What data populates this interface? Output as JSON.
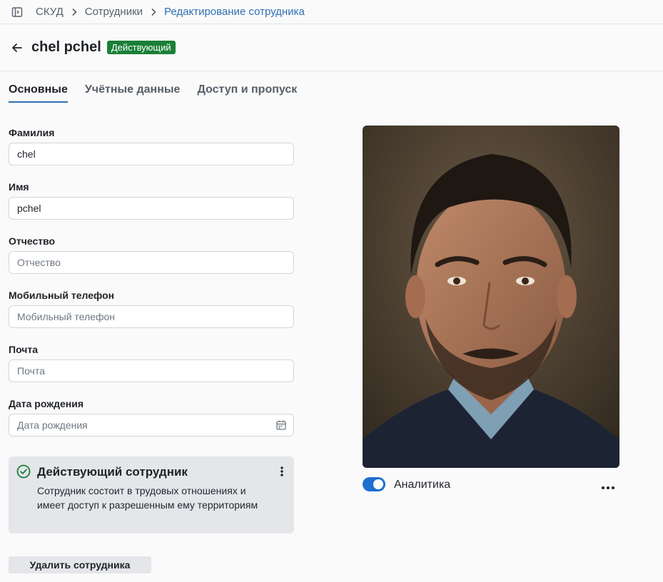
{
  "breadcrumb": {
    "items": [
      "СКУД",
      "Сотрудники",
      "Редактирование сотрудника"
    ]
  },
  "header": {
    "title": "chel pchel",
    "status_badge": "Действующий"
  },
  "tabs": [
    {
      "label": "Основные",
      "active": true
    },
    {
      "label": "Учётные данные",
      "active": false
    },
    {
      "label": "Доступ и пропуск",
      "active": false
    }
  ],
  "form": {
    "last_name": {
      "label": "Фамилия",
      "value": "chel",
      "placeholder": "Фамилия"
    },
    "first_name": {
      "label": "Имя",
      "value": "pchel",
      "placeholder": "Имя"
    },
    "middle_name": {
      "label": "Отчество",
      "value": "",
      "placeholder": "Отчество"
    },
    "phone": {
      "label": "Мобильный телефон",
      "value": "",
      "placeholder": "Мобильный телефон"
    },
    "email": {
      "label": "Почта",
      "value": "",
      "placeholder": "Почта"
    },
    "birth_date": {
      "label": "Дата рождения",
      "value": "",
      "placeholder": "Дата рождения"
    }
  },
  "status_card": {
    "title": "Действующий сотрудник",
    "description": "Сотрудник состоит в трудовых отношениях и имеет доступ к разрешенным ему территориям"
  },
  "actions": {
    "delete_label": "Удалить сотрудника"
  },
  "photo_panel": {
    "toggle_label": "Аналитика",
    "toggle_on": true
  },
  "colors": {
    "accent": "#2f6fb3",
    "status_green": "#1a7f37",
    "toggle_blue": "#1f6fd0"
  }
}
